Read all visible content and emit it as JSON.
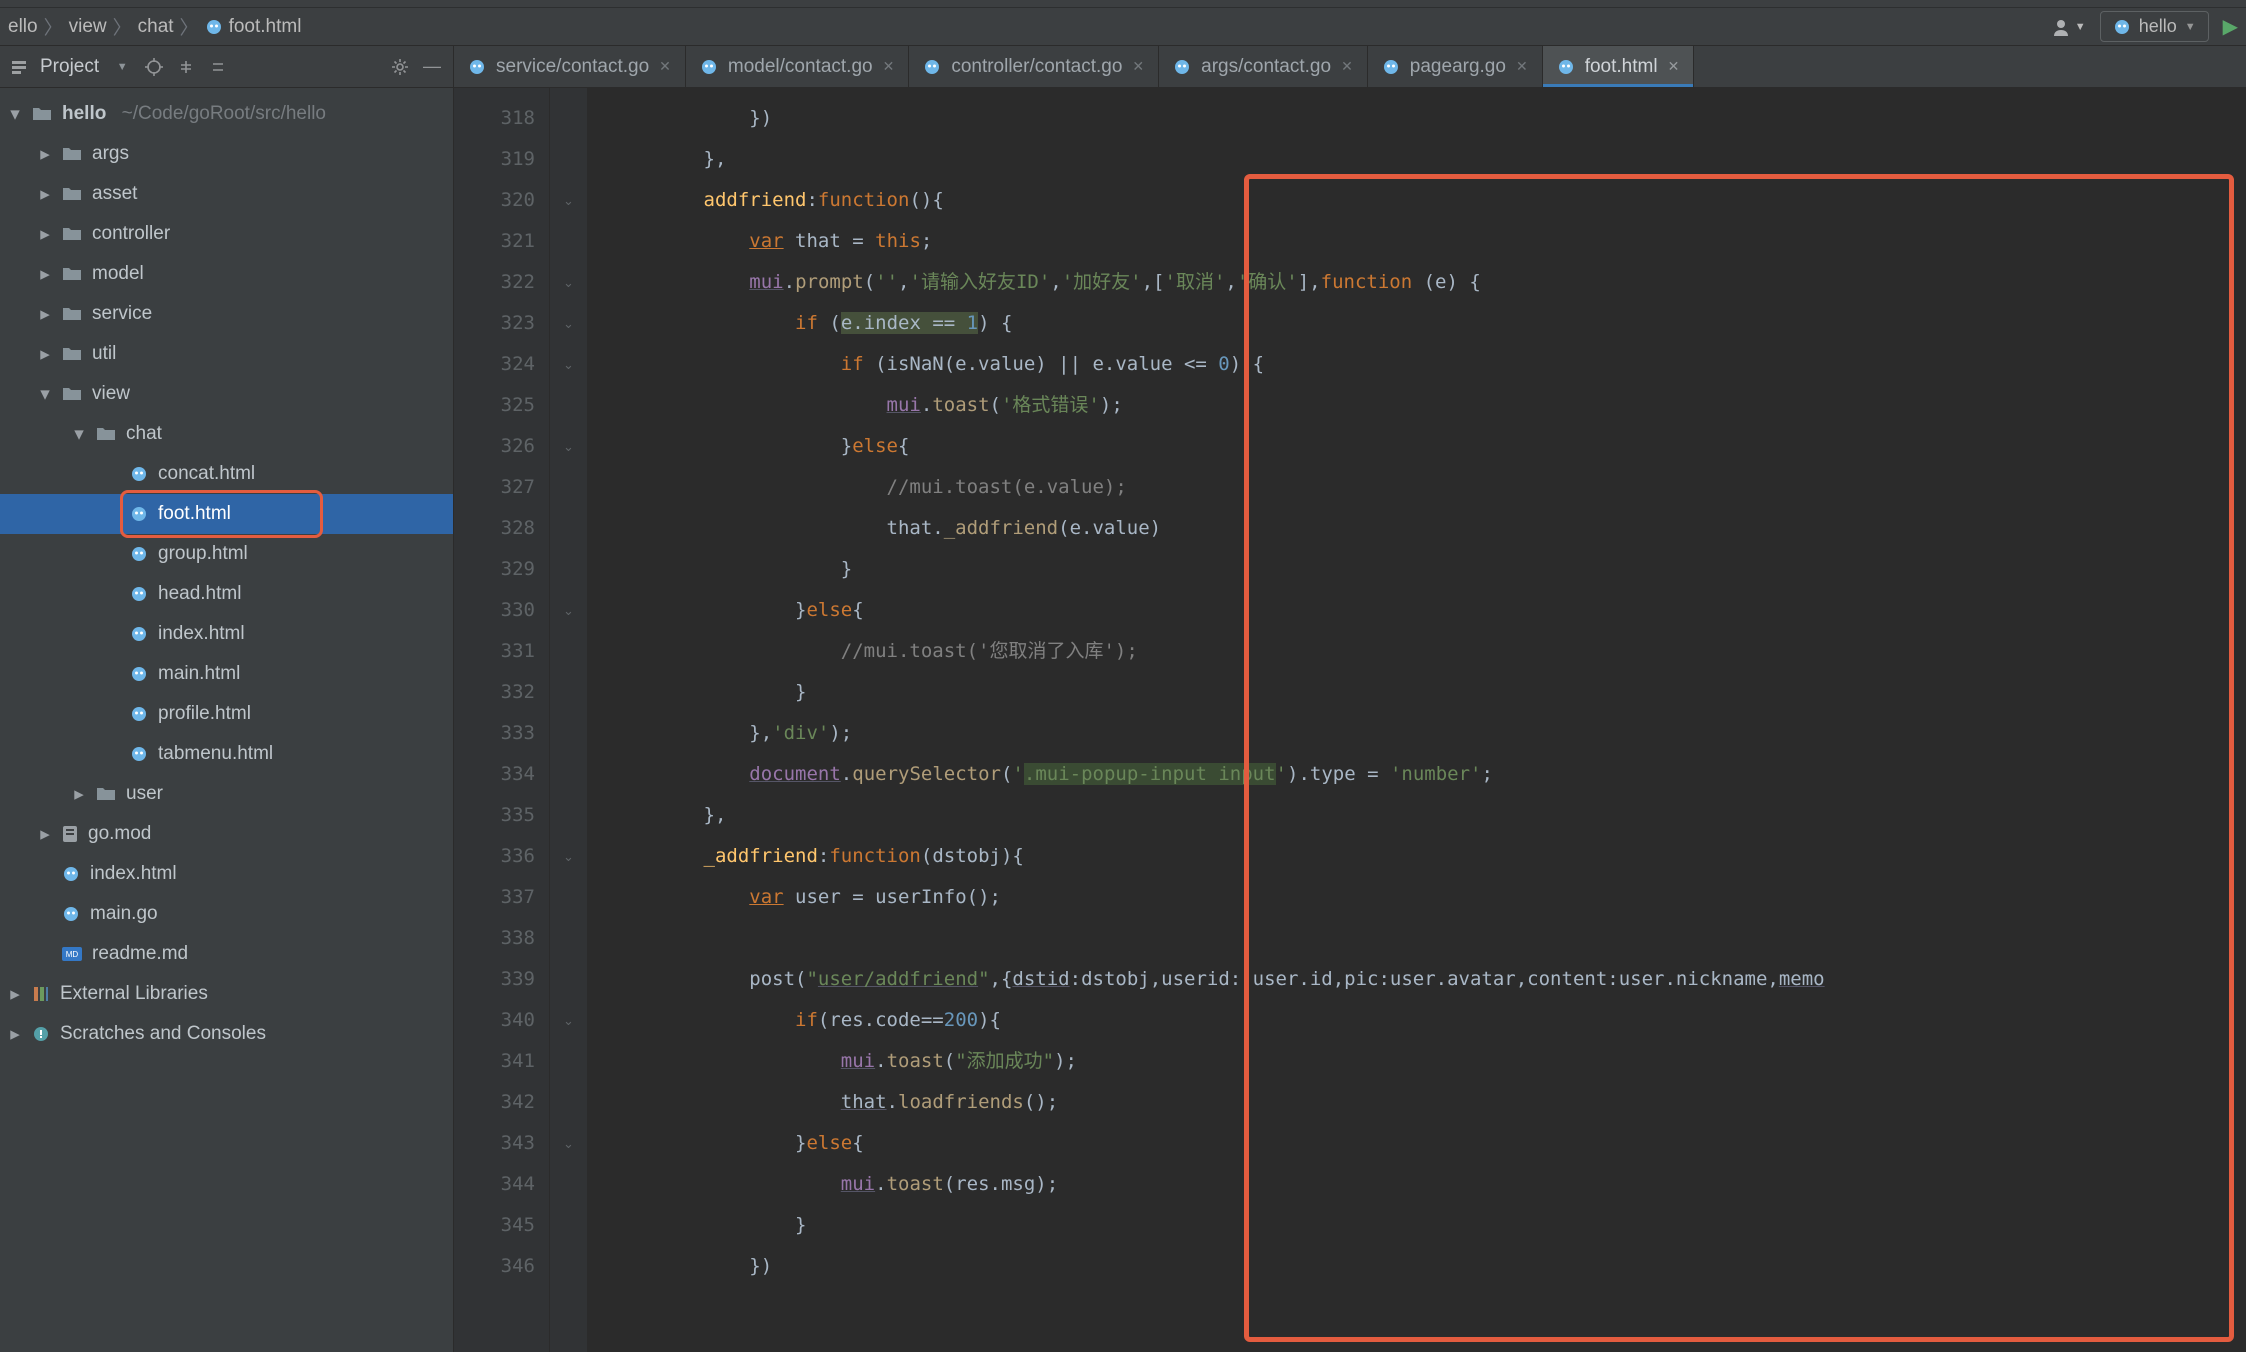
{
  "breadcrumb": {
    "parts": [
      "ello",
      "view",
      "chat",
      "foot.html"
    ]
  },
  "toolbar": {
    "run_config": "hello"
  },
  "project_header": {
    "title": "Project"
  },
  "tabs": [
    {
      "label": "service/contact.go",
      "type": "go",
      "active": false
    },
    {
      "label": "model/contact.go",
      "type": "go",
      "active": false
    },
    {
      "label": "controller/contact.go",
      "type": "go",
      "active": false
    },
    {
      "label": "args/contact.go",
      "type": "go",
      "active": false
    },
    {
      "label": "pagearg.go",
      "type": "go",
      "active": false
    },
    {
      "label": "foot.html",
      "type": "gohtml",
      "active": true
    }
  ],
  "tree": [
    {
      "depth": 0,
      "kind": "root",
      "twisty": "down",
      "label": "hello",
      "suffix": "~/Code/goRoot/src/hello"
    },
    {
      "depth": 1,
      "kind": "dir",
      "twisty": "right",
      "label": "args"
    },
    {
      "depth": 1,
      "kind": "dir",
      "twisty": "right",
      "label": "asset"
    },
    {
      "depth": 1,
      "kind": "dir",
      "twisty": "right",
      "label": "controller"
    },
    {
      "depth": 1,
      "kind": "dir",
      "twisty": "right",
      "label": "model"
    },
    {
      "depth": 1,
      "kind": "dir",
      "twisty": "right",
      "label": "service"
    },
    {
      "depth": 1,
      "kind": "dir",
      "twisty": "right",
      "label": "util"
    },
    {
      "depth": 1,
      "kind": "dir",
      "twisty": "down",
      "label": "view"
    },
    {
      "depth": 2,
      "kind": "dir",
      "twisty": "down",
      "label": "chat"
    },
    {
      "depth": 3,
      "kind": "gohtml",
      "label": "concat.html"
    },
    {
      "depth": 3,
      "kind": "gohtml",
      "label": "foot.html",
      "selected": true,
      "highlight": true
    },
    {
      "depth": 3,
      "kind": "gohtml",
      "label": "group.html"
    },
    {
      "depth": 3,
      "kind": "gohtml",
      "label": "head.html"
    },
    {
      "depth": 3,
      "kind": "gohtml",
      "label": "index.html"
    },
    {
      "depth": 3,
      "kind": "gohtml",
      "label": "main.html"
    },
    {
      "depth": 3,
      "kind": "gohtml",
      "label": "profile.html"
    },
    {
      "depth": 3,
      "kind": "gohtml",
      "label": "tabmenu.html"
    },
    {
      "depth": 2,
      "kind": "dir",
      "twisty": "right",
      "label": "user"
    },
    {
      "depth": 1,
      "kind": "gomod",
      "twisty": "right",
      "label": "go.mod"
    },
    {
      "depth": 1,
      "kind": "gohtml",
      "label": "index.html"
    },
    {
      "depth": 1,
      "kind": "go",
      "label": "main.go"
    },
    {
      "depth": 1,
      "kind": "md",
      "label": "readme.md"
    },
    {
      "depth": 0,
      "kind": "lib",
      "twisty": "right",
      "label": "External Libraries"
    },
    {
      "depth": 0,
      "kind": "scratch",
      "twisty": "right",
      "label": "Scratches and Consoles"
    }
  ],
  "editor": {
    "first_line_no": 318,
    "lines": [
      {
        "html": "            })"
      },
      {
        "html": "        },"
      },
      {
        "html": "        <span class='k-ident'>addfriend</span>:<span class='k-fn'>function</span>(){"
      },
      {
        "html": "            <span class='k-var'>var</span> that = <span class='k-this'>this</span>;"
      },
      {
        "html": "            <span class='k-obj k-under'>mui</span>.<span class='k-call'>prompt</span>(<span class='k-str'>''</span>,<span class='k-str'>'请输入好友ID'</span>,<span class='k-str'>'加好友'</span>,[<span class='k-str'>'取消'</span>,<span class='k-str'>'确认'</span>],<span class='k-fn'>function </span>(e) {"
      },
      {
        "html": "                <span class='k-key'>if </span>(<span class='k-litbg'>e.index == <span class='k-num'>1</span></span>) {"
      },
      {
        "html": "                    <span class='k-key'>if </span>(isNaN(e.value) || e.value &lt;= <span class='k-num'>0</span>) {"
      },
      {
        "html": "                        <span class='k-obj k-under'>mui</span>.<span class='k-call'>toast</span>(<span class='k-str'>'格式错误'</span>);"
      },
      {
        "html": "                    }<span class='k-key'>else</span>{"
      },
      {
        "html": "                        <span class='k-cmt'>//mui.toast(e.value);</span>"
      },
      {
        "html": "                        that.<span class='k-call'>_addfriend</span>(e.value)"
      },
      {
        "html": "                    }"
      },
      {
        "html": "                }<span class='k-key'>else</span>{"
      },
      {
        "html": "                    <span class='k-cmt'>//mui.toast('您取消了入库');</span>"
      },
      {
        "html": "                }"
      },
      {
        "html": "            },<span class='k-str'>'div'</span>);"
      },
      {
        "html": "            <span class='k-obj k-under'>document</span>.<span class='k-call'>querySelector</span>(<span class='k-str'>'</span><span class='k-hlbg k-str'>.mui-popup-input input</span><span class='k-str'>'</span>).type = <span class='k-str'>'number'</span>;"
      },
      {
        "html": "        },"
      },
      {
        "html": "        <span class='k-ident'>_addfriend</span>:<span class='k-fn'>function</span>(<span class='k-params'>dstobj</span>){"
      },
      {
        "html": "            <span class='k-var'>var</span> user = userInfo();"
      },
      {
        "html": ""
      },
      {
        "html": "            post(<span class='k-str'>\"<span class='k-under'>user/addfriend</span>\"</span>,{<span class='k-under'>dstid</span>:dstobj,userid: user.id,pic:user.avatar,content:user.nickname,<span class='k-under'>memo</span>"
      },
      {
        "html": "                <span class='k-key'>if</span>(res.code==<span class='k-num'>200</span>){"
      },
      {
        "html": "                    <span class='k-obj k-under'>mui</span>.<span class='k-call'>toast</span>(<span class='k-str'>\"添加成功\"</span>);"
      },
      {
        "html": "                    <span class='k-under'>that</span>.<span class='k-call'>loadfriends</span>();"
      },
      {
        "html": "                }<span class='k-key'>else</span>{"
      },
      {
        "html": "                    <span class='k-obj k-under'>mui</span>.<span class='k-call'>toast</span>(res.msg);"
      },
      {
        "html": "                }"
      },
      {
        "html": "            })"
      }
    ]
  }
}
